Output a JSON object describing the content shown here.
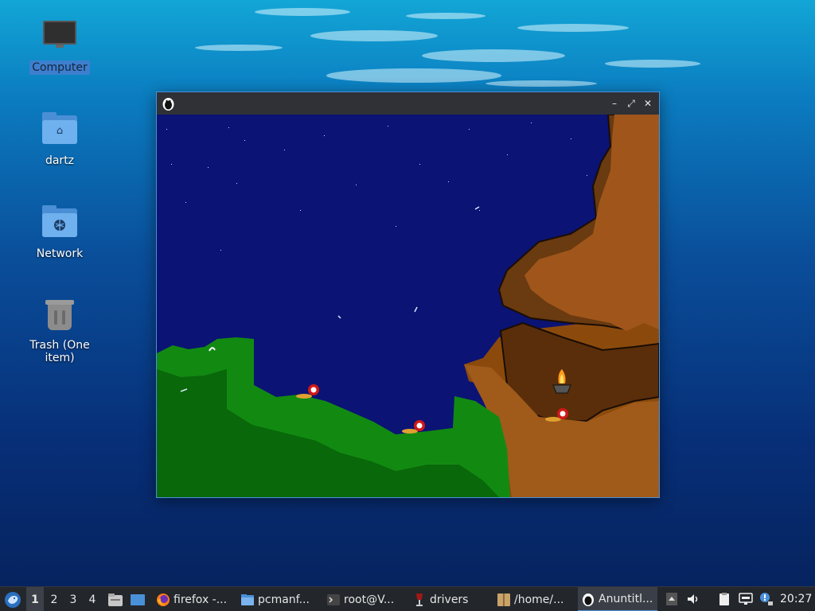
{
  "desktop": {
    "icons": [
      {
        "label": "Computer",
        "icon": "computer-icon",
        "selected": true
      },
      {
        "label": "dartz",
        "icon": "home-folder-icon"
      },
      {
        "label": "Network",
        "icon": "network-folder-icon"
      },
      {
        "label": "Trash (One item)",
        "icon": "trash-icon"
      }
    ]
  },
  "window": {
    "app_icon": "penguin-icon",
    "controls": {
      "minimize": "–",
      "maximize": "⤢",
      "close": "✕"
    }
  },
  "taskbar": {
    "start_icon": "start-menu-icon",
    "workspaces": [
      "1",
      "2",
      "3",
      "4"
    ],
    "active_workspace": "1",
    "launchers": [
      "file-manager-icon",
      "show-desktop-icon"
    ],
    "tasks": [
      {
        "label": "firefox -...",
        "icon": "firefox-icon"
      },
      {
        "label": "pcmanf...",
        "icon": "folder-icon"
      },
      {
        "label": "root@V...",
        "icon": "terminal-icon"
      },
      {
        "label": "drivers",
        "icon": "wine-icon"
      },
      {
        "label": "/home/...",
        "icon": "archive-icon"
      },
      {
        "label": "Anuntitl...",
        "icon": "penguin-icon",
        "active": true
      }
    ],
    "tray_icons": [
      "scroll-up-icon",
      "volume-icon",
      "clipboard-icon",
      "network-status-icon",
      "notification-icon"
    ],
    "clock": "20:27"
  },
  "colors": {
    "sky": "#0b1374",
    "grass": "#128a12",
    "grass_dark": "#096809",
    "dirt": "#8b4a0c",
    "dirt_light": "#a05a1a",
    "accent": "#4a90d9"
  }
}
